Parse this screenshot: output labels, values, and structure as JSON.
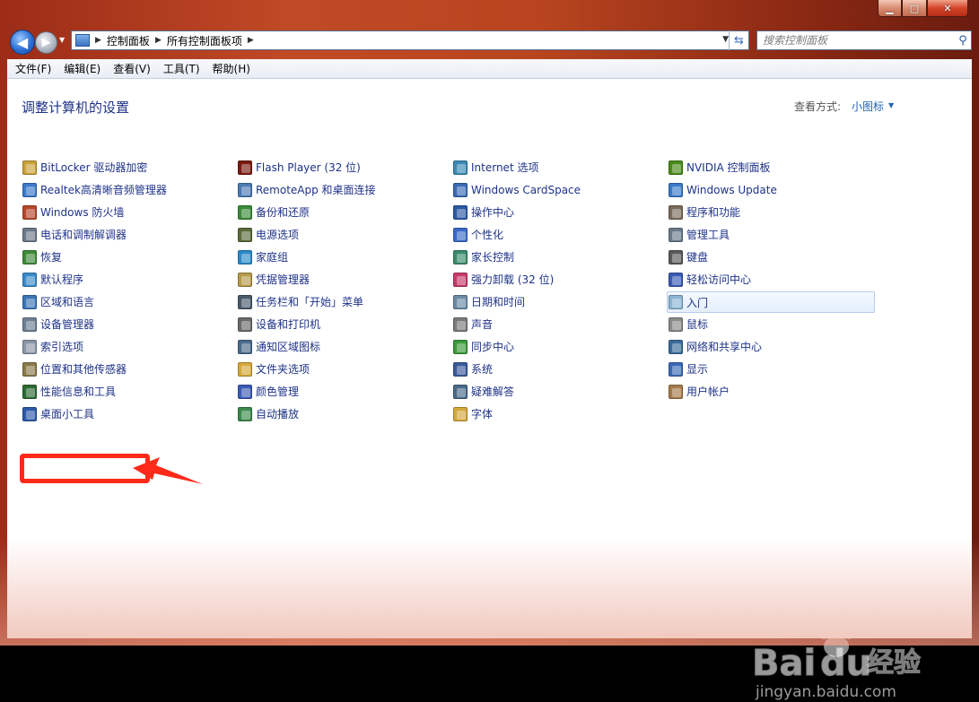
{
  "window": {
    "minimize_glyph": "▁",
    "maximize_glyph": "□",
    "close_glyph": "✕"
  },
  "nav": {
    "back_glyph": "◀",
    "forward_glyph": "▶",
    "breadcrumb": [
      "控制面板",
      "所有控制面板项"
    ],
    "search_placeholder": "搜索控制面板"
  },
  "menu": {
    "items": [
      "文件(F)",
      "编辑(E)",
      "查看(V)",
      "工具(T)",
      "帮助(H)"
    ]
  },
  "header": {
    "title": "调整计算机的设置",
    "view_label": "查看方式:",
    "view_value": "小图标"
  },
  "columns": [
    [
      {
        "label": "BitLocker 驱动器加密",
        "icon": "bitlocker-icon",
        "color": "#c9a23a"
      },
      {
        "label": "Realtek高清晰音频管理器",
        "icon": "realtek-audio-icon",
        "color": "#3a7ac9"
      },
      {
        "label": "Windows 防火墙",
        "icon": "firewall-icon",
        "color": "#b5482a"
      },
      {
        "label": "电话和调制解调器",
        "icon": "phone-modem-icon",
        "color": "#6c7a8a"
      },
      {
        "label": "恢复",
        "icon": "recovery-icon",
        "color": "#3f8a3a"
      },
      {
        "label": "默认程序",
        "icon": "default-programs-icon",
        "color": "#3a8ac9"
      },
      {
        "label": "区域和语言",
        "icon": "region-language-icon",
        "color": "#3a76b5"
      },
      {
        "label": "设备管理器",
        "icon": "device-manager-icon",
        "color": "#6d7f93"
      },
      {
        "label": "索引选项",
        "icon": "indexing-icon",
        "color": "#8a96a6"
      },
      {
        "label": "位置和其他传感器",
        "icon": "location-sensor-icon",
        "color": "#8a7a4a"
      },
      {
        "label": "性能信息和工具",
        "icon": "performance-icon",
        "color": "#2c6b34"
      },
      {
        "label": "桌面小工具",
        "icon": "gadgets-icon",
        "color": "#2d5aa8"
      }
    ],
    [
      {
        "label": "Flash Player (32 位)",
        "icon": "flash-icon",
        "color": "#7a1a10"
      },
      {
        "label": "RemoteApp 和桌面连接",
        "icon": "remoteapp-icon",
        "color": "#4a7ab5"
      },
      {
        "label": "备份和还原",
        "icon": "backup-icon",
        "color": "#3a8a3a"
      },
      {
        "label": "电源选项",
        "icon": "power-icon",
        "color": "#5a6a3a"
      },
      {
        "label": "家庭组",
        "icon": "homegroup-icon",
        "color": "#2a8ac9"
      },
      {
        "label": "凭据管理器",
        "icon": "credential-icon",
        "color": "#b59a4a"
      },
      {
        "label": "任务栏和「开始」菜单",
        "icon": "taskbar-icon",
        "color": "#4a5a6a"
      },
      {
        "label": "设备和打印机",
        "icon": "printer-icon",
        "color": "#6a6a6a"
      },
      {
        "label": "通知区域图标",
        "icon": "notification-icon",
        "color": "#4a6a8a"
      },
      {
        "label": "文件夹选项",
        "icon": "folder-options-icon",
        "color": "#d4a83a"
      },
      {
        "label": "颜色管理",
        "icon": "color-management-icon",
        "color": "#3a5ab5"
      },
      {
        "label": "自动播放",
        "icon": "autoplay-icon",
        "color": "#3a8a4a"
      }
    ],
    [
      {
        "label": "Internet 选项",
        "icon": "internet-options-icon",
        "color": "#3a8ab5"
      },
      {
        "label": "Windows CardSpace",
        "icon": "cardspace-icon",
        "color": "#3a6ab5"
      },
      {
        "label": "操作中心",
        "icon": "action-center-icon",
        "color": "#2a5aa5"
      },
      {
        "label": "个性化",
        "icon": "personalization-icon",
        "color": "#3a6ac9"
      },
      {
        "label": "家长控制",
        "icon": "parental-control-icon",
        "color": "#3a8a6a"
      },
      {
        "label": "强力卸载 (32 位)",
        "icon": "uninstaller-icon",
        "color": "#c93a6a"
      },
      {
        "label": "日期和时间",
        "icon": "date-time-icon",
        "color": "#6a8aa5"
      },
      {
        "label": "声音",
        "icon": "sound-icon",
        "color": "#7a7a7a"
      },
      {
        "label": "同步中心",
        "icon": "sync-center-icon",
        "color": "#3a9a3a"
      },
      {
        "label": "系统",
        "icon": "system-icon",
        "color": "#3a5a9a"
      },
      {
        "label": "疑难解答",
        "icon": "troubleshooting-icon",
        "color": "#4a6a8a"
      },
      {
        "label": "字体",
        "icon": "fonts-icon",
        "color": "#d4a83a"
      }
    ],
    [
      {
        "label": "NVIDIA 控制面板",
        "icon": "nvidia-icon",
        "color": "#4a8a1a"
      },
      {
        "label": "Windows Update",
        "icon": "windows-update-icon",
        "color": "#3a7ac9"
      },
      {
        "label": "程序和功能",
        "icon": "programs-features-icon",
        "color": "#7a6a5a"
      },
      {
        "label": "管理工具",
        "icon": "admin-tools-icon",
        "color": "#6a7a8a"
      },
      {
        "label": "键盘",
        "icon": "keyboard-icon",
        "color": "#5a5a5a"
      },
      {
        "label": "轻松访问中心",
        "icon": "ease-of-access-icon",
        "color": "#3a5ab5"
      },
      {
        "label": "入门",
        "icon": "getting-started-icon",
        "color": "#8ab5d4"
      },
      {
        "label": "鼠标",
        "icon": "mouse-icon",
        "color": "#8a8a8a"
      },
      {
        "label": "网络和共享中心",
        "icon": "network-sharing-icon",
        "color": "#3a6a9a"
      },
      {
        "label": "显示",
        "icon": "display-icon",
        "color": "#3a6ab5"
      },
      {
        "label": "用户帐户",
        "icon": "user-accounts-icon",
        "color": "#a57a4a"
      }
    ]
  ],
  "watermark": {
    "brand": "Bai",
    "brand2": "du",
    "cn": "经验",
    "url": "jingyan.baidu.com"
  },
  "colors": {
    "link": "#1e3287",
    "annotation": "#ff2a1a"
  }
}
